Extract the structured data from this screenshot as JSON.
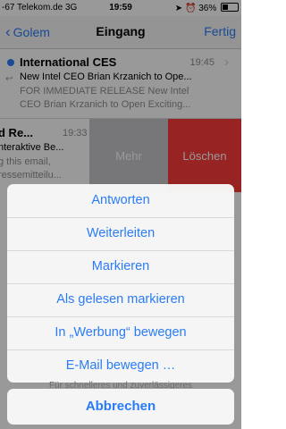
{
  "status": {
    "carrier": "-67 Telekom.de  3G",
    "time": "19:59",
    "battery": "36%",
    "battery_level": 0.36
  },
  "nav": {
    "back": "Golem",
    "title": "Eingang",
    "done": "Fertig"
  },
  "mail1": {
    "sender": "International CES",
    "time": "19:45",
    "subject": "New Intel CEO Brian Krzanich to Ope...",
    "preview_line1": "FOR IMMEDIATE RELEASE New Intel",
    "preview_line2": "CEO Brian Krzanich to Open Exciting..."
  },
  "mail2": {
    "sender": "d Re...",
    "time": "19:33",
    "subject": "nteraktive Be...",
    "preview_line1": "g this email,",
    "preview_line2": "ressemitteilu..."
  },
  "swipe": {
    "more": "Mehr",
    "delete": "Löschen"
  },
  "sheet": {
    "items": [
      "Antworten",
      "Weiterleiten",
      "Markieren",
      "Als gelesen markieren",
      "In „Werbung“ bewegen",
      "E-Mail bewegen …"
    ],
    "cancel": "Abbrechen",
    "behind_text": "Für schnelleres und zuverlässigeres"
  },
  "colors": {
    "accent": "#2a7cf6",
    "delete": "#fc3d39",
    "more": "#c7c7cc"
  }
}
